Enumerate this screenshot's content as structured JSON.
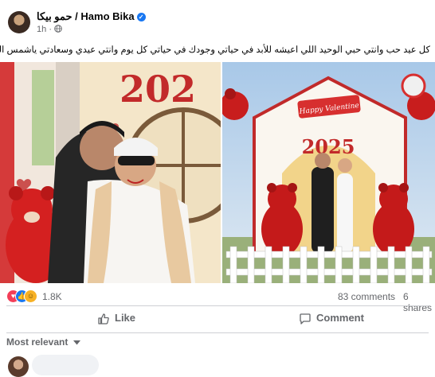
{
  "post": {
    "author_ar": "حمو بيكا",
    "separator": " / ",
    "author_en": "Hamo Bika",
    "time": "1h",
    "caption": "كل عيد حب وانتي حبي الوحيد اللي اعيشه للأبد في حياتي وجودك في حياتي كل يوم وانتي  عيدي وسعادتي  ياشمس المجرة 😍😍❤️"
  },
  "photo_right": {
    "sign_text": "Happy Valentine",
    "year_text": "2025"
  },
  "photo_left": {
    "year_text": "202"
  },
  "stats": {
    "reactions": "1.8K",
    "comments": "83 comments",
    "shares": "6 shares"
  },
  "actions": {
    "like_label": "Like",
    "comment_label": "Comment"
  },
  "comments": {
    "sort_label": "Most relevant"
  },
  "colors": {
    "accent": "#1877f2",
    "secondary_text": "#65676b",
    "divider": "#ced0d4"
  },
  "icons": {
    "verified": "verified-badge-icon",
    "privacy": "globe-icon",
    "like": "thumbs-up-icon",
    "comment": "comment-bubble-icon",
    "sort": "chevron-down-icon"
  }
}
